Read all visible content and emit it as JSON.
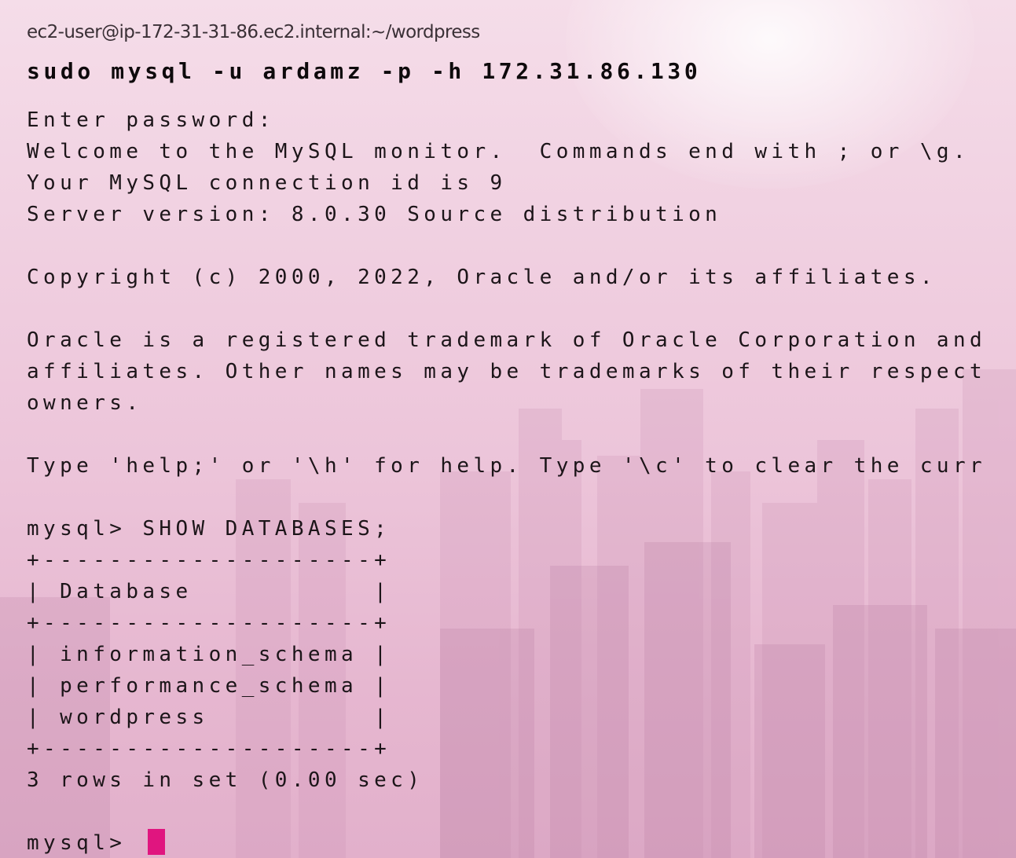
{
  "session": {
    "prompt_header": "ec2-user@ip-172-31-31-86.ec2.internal:~/wordpress",
    "command": "sudo mysql -u ardamz -p -h 172.31.86.130"
  },
  "output": {
    "enter_password": "Enter password:",
    "welcome": "Welcome to the MySQL monitor.  Commands end with ; or \\g.",
    "connection_id": "Your MySQL connection id is 9",
    "server_version": "Server version: 8.0.30 Source distribution",
    "copyright": "Copyright (c) 2000, 2022, Oracle and/or its affiliates.",
    "trademark_1": "Oracle is a registered trademark of Oracle Corporation and",
    "trademark_2": "affiliates. Other names may be trademarks of their respect",
    "trademark_3": "owners.",
    "help": "Type 'help;' or '\\h' for help. Type '\\c' to clear the curr"
  },
  "query": {
    "prompt_line": "mysql> SHOW DATABASES;",
    "border": "+--------------------+",
    "header_row": "| Database           |",
    "rows": [
      "| information_schema |",
      "| performance_schema |",
      "| wordpress          |"
    ],
    "summary": "3 rows in set (0.00 sec)"
  },
  "input": {
    "prompt": "mysql>"
  },
  "colors": {
    "cursor": "#e0157f",
    "text": "#1c1519"
  }
}
